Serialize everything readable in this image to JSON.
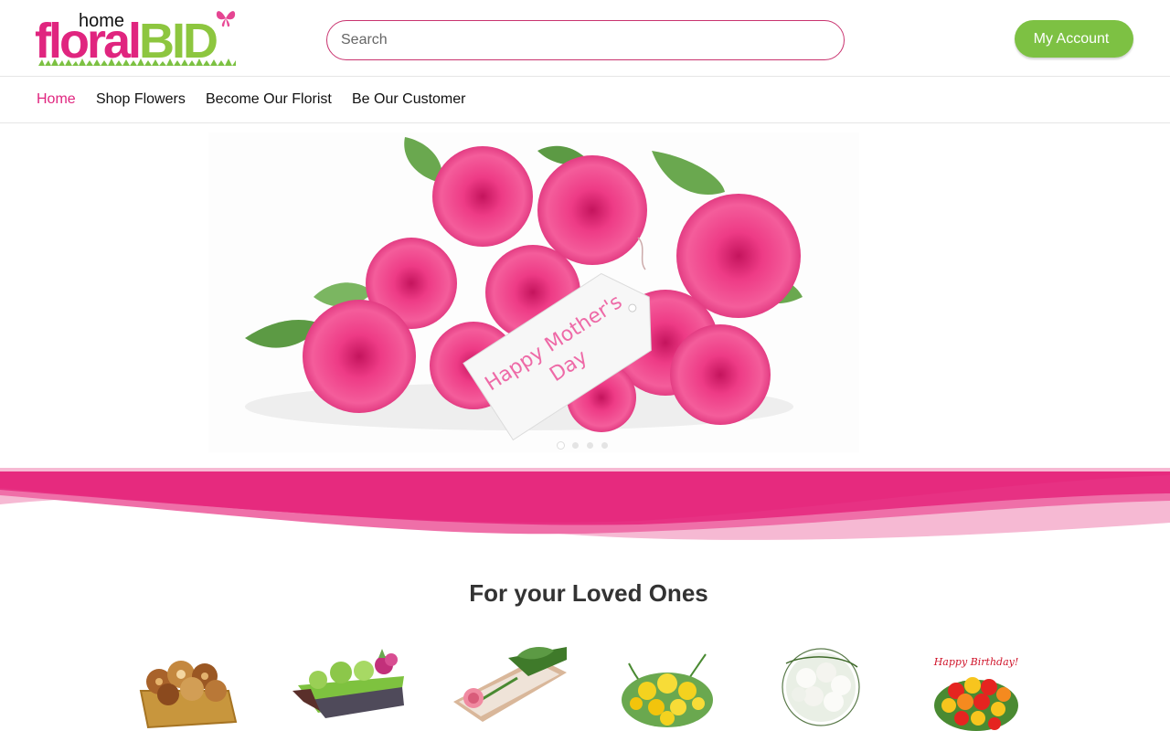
{
  "header": {
    "logo": {
      "small_text": "home",
      "part1": "floral",
      "part2": "BID"
    },
    "search": {
      "placeholder": "Search",
      "value": ""
    },
    "account_button": {
      "label": "My Account",
      "caret": ""
    }
  },
  "nav": {
    "items": [
      {
        "label": "Home",
        "active": true
      },
      {
        "label": "Shop Flowers",
        "active": false
      },
      {
        "label": "Become Our Florist",
        "active": false
      },
      {
        "label": "Be Our Customer",
        "active": false
      }
    ]
  },
  "hero": {
    "tag_line1": "Happy Mother's",
    "tag_line2": "Day",
    "slide_count": 4,
    "active_slide": 1
  },
  "section": {
    "title": "For your Loved Ones"
  },
  "products": [
    {
      "name": "pastry-basket"
    },
    {
      "name": "green-moss-planter"
    },
    {
      "name": "rose-gift-box"
    },
    {
      "name": "yellow-bouquet"
    },
    {
      "name": "white-rose-bouquet"
    },
    {
      "name": "birthday-roses",
      "card_text": "Happy Birthday!"
    }
  ],
  "colors": {
    "brand_pink": "#e0257f",
    "brand_green": "#8dc63f",
    "button_green": "#7dc143",
    "wave_pink": "#e62a7e",
    "wave_light": "#f6b9d3"
  }
}
